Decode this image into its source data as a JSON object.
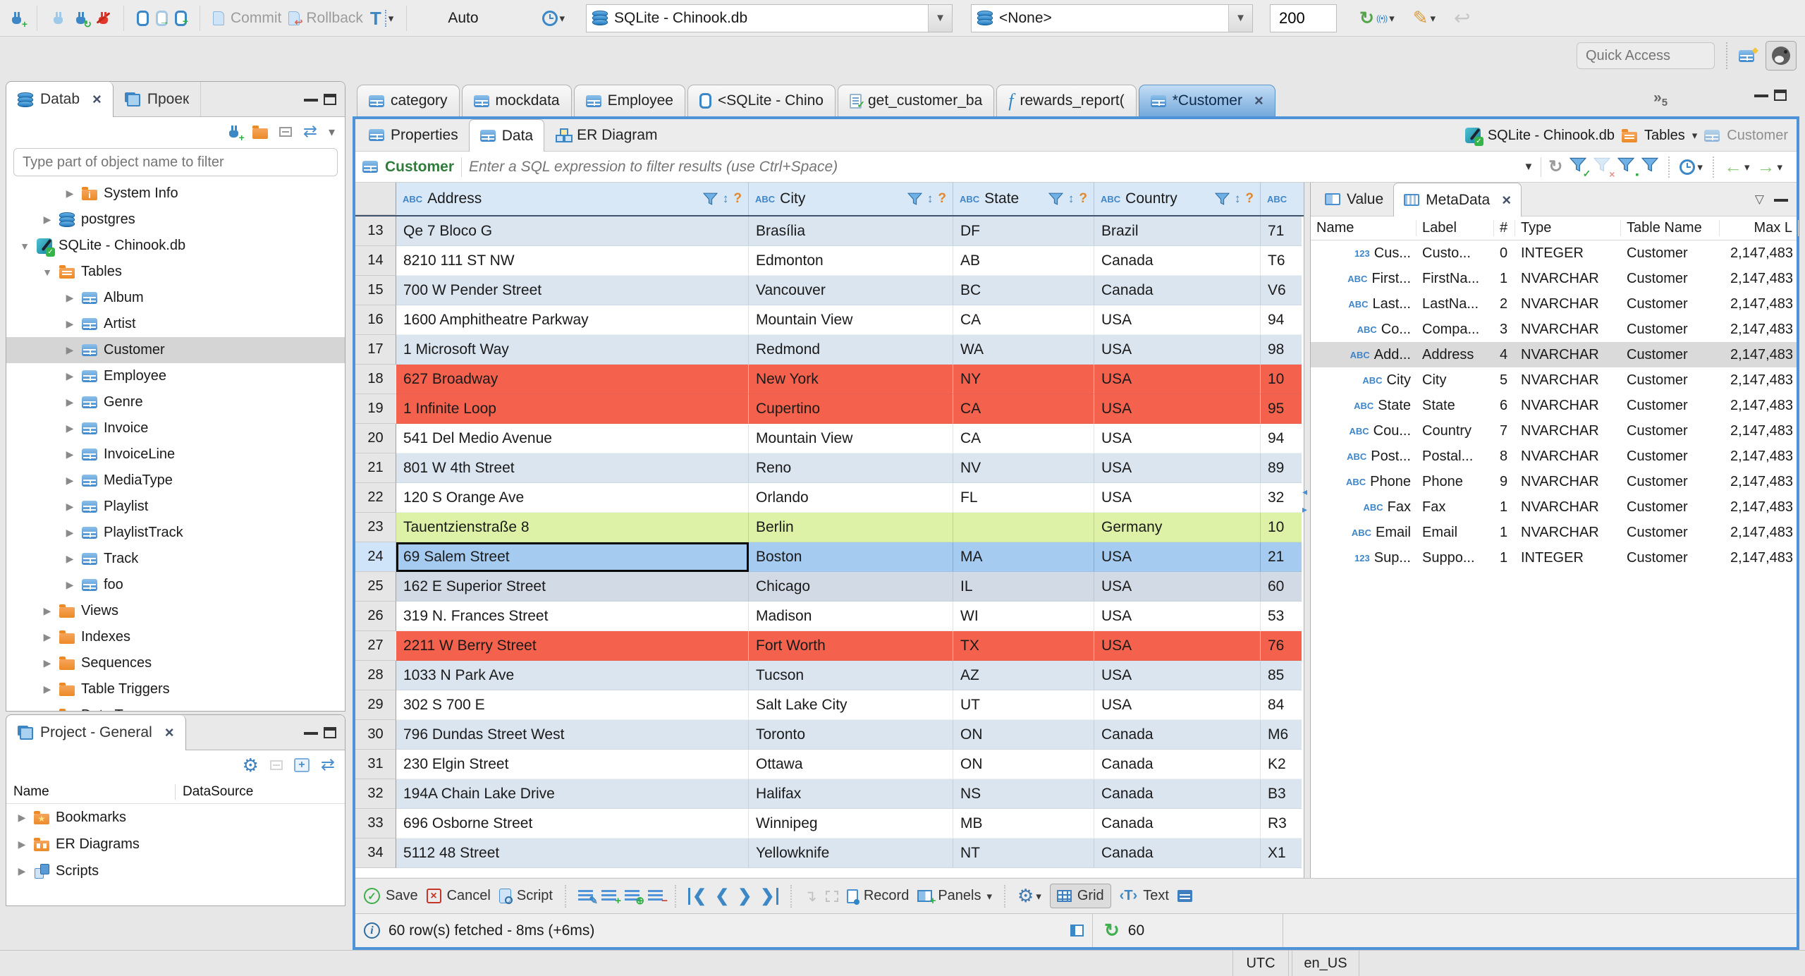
{
  "colors": {
    "accent": "#4e93d8",
    "row_red": "#f4614c",
    "row_green": "#ddf2a6",
    "row_alt": "#dbe5f0",
    "row_selected": "#a6cbf0",
    "row_gray": "#d2dbe5",
    "header_blue": "#d9e8f7",
    "filter_table_green": "#2e7d39",
    "tab_active_top": "#c3ddf5",
    "tab_active_bottom": "#74a9dc"
  },
  "icons": {
    "tree_collapsed": "▶",
    "tree_expanded": "▼",
    "dropdown_caret": "▾",
    "combo_arrow": "▼",
    "refresh": "↻",
    "sort": "↕",
    "unknown_sort": "?",
    "link_editor": "⇄",
    "close": "×",
    "overflow_chevrons": "»",
    "left_arrow": "←",
    "right_arrow": "→",
    "text_type_badge": "ABC",
    "numeric_type_badge": "123",
    "panel_chevron": "▽"
  },
  "topbar": {
    "commit_label": "Commit",
    "rollback_label": "Rollback",
    "auto_label": "Auto",
    "database_combo": "SQLite - Chinook.db",
    "schema_combo": "<None>",
    "fetch_size": "200",
    "quick_access_placeholder": "Quick Access"
  },
  "navigator": {
    "tab_database_label": "Datab",
    "tab_projects_label": "Проек",
    "filter_placeholder": "Type part of object name to filter",
    "tree": [
      {
        "label": "System Info",
        "level": 2,
        "state": "collapsed",
        "icon": "folder-info"
      },
      {
        "label": "postgres",
        "level": 1,
        "state": "collapsed",
        "icon": "db"
      },
      {
        "label": "SQLite - Chinook.db",
        "level": 0,
        "state": "expanded",
        "icon": "sqlite"
      },
      {
        "label": "Tables",
        "level": 1,
        "state": "expanded",
        "icon": "folder-table"
      },
      {
        "label": "Album",
        "level": 2,
        "state": "collapsed",
        "icon": "table"
      },
      {
        "label": "Artist",
        "level": 2,
        "state": "collapsed",
        "icon": "table"
      },
      {
        "label": "Customer",
        "level": 2,
        "state": "collapsed",
        "icon": "table",
        "selected": true
      },
      {
        "label": "Employee",
        "level": 2,
        "state": "collapsed",
        "icon": "table"
      },
      {
        "label": "Genre",
        "level": 2,
        "state": "collapsed",
        "icon": "table"
      },
      {
        "label": "Invoice",
        "level": 2,
        "state": "collapsed",
        "icon": "table"
      },
      {
        "label": "InvoiceLine",
        "level": 2,
        "state": "collapsed",
        "icon": "table"
      },
      {
        "label": "MediaType",
        "level": 2,
        "state": "collapsed",
        "icon": "table"
      },
      {
        "label": "Playlist",
        "level": 2,
        "state": "collapsed",
        "icon": "table"
      },
      {
        "label": "PlaylistTrack",
        "level": 2,
        "state": "collapsed",
        "icon": "table"
      },
      {
        "label": "Track",
        "level": 2,
        "state": "collapsed",
        "icon": "table"
      },
      {
        "label": "foo",
        "level": 2,
        "state": "collapsed",
        "icon": "table"
      },
      {
        "label": "Views",
        "level": 1,
        "state": "collapsed",
        "icon": "folder"
      },
      {
        "label": "Indexes",
        "level": 1,
        "state": "collapsed",
        "icon": "folder"
      },
      {
        "label": "Sequences",
        "level": 1,
        "state": "collapsed",
        "icon": "folder"
      },
      {
        "label": "Table Triggers",
        "level": 1,
        "state": "collapsed",
        "icon": "folder"
      },
      {
        "label": "Data Types",
        "level": 1,
        "state": "collapsed",
        "icon": "folder"
      }
    ]
  },
  "project_panel": {
    "title": "Project - General",
    "columns": [
      "Name",
      "DataSource"
    ],
    "items": [
      {
        "label": "Bookmarks",
        "icon": "folder-star"
      },
      {
        "label": "ER Diagrams",
        "icon": "folder-er"
      },
      {
        "label": "Scripts",
        "icon": "scripts"
      }
    ]
  },
  "editor": {
    "tabs": [
      {
        "label": "category",
        "icon": "table"
      },
      {
        "label": "mockdata",
        "icon": "table"
      },
      {
        "label": "Employee",
        "icon": "table"
      },
      {
        "label": "<SQLite - Chino",
        "icon": "sqlscript"
      },
      {
        "label": "get_customer_ba",
        "icon": "script-check"
      },
      {
        "label": "rewards_report(",
        "icon": "func"
      },
      {
        "label": "*Customer",
        "icon": "table",
        "active": true
      }
    ],
    "overflow_count": "5",
    "result_tabs": [
      {
        "label": "Properties"
      },
      {
        "label": "Data",
        "active": true
      },
      {
        "label": "ER Diagram"
      }
    ],
    "breadcrumb": {
      "database": "SQLite - Chinook.db",
      "container": "Tables",
      "table": "Customer"
    }
  },
  "filter_bar": {
    "table_label": "Customer",
    "placeholder": "Enter a SQL expression to filter results (use Ctrl+Space)"
  },
  "grid": {
    "columns": [
      "Address",
      "City",
      "State",
      "Country"
    ],
    "rows": [
      {
        "num": "13",
        "bg": "alt",
        "cells": [
          "Qe 7 Bloco G",
          "Brasília",
          "DF",
          "Brazil",
          "71"
        ]
      },
      {
        "num": "14",
        "bg": "white",
        "cells": [
          "8210 111 ST NW",
          "Edmonton",
          "AB",
          "Canada",
          "T6"
        ]
      },
      {
        "num": "15",
        "bg": "alt",
        "cells": [
          "700 W Pender Street",
          "Vancouver",
          "BC",
          "Canada",
          "V6"
        ]
      },
      {
        "num": "16",
        "bg": "white",
        "cells": [
          "1600 Amphitheatre Parkway",
          "Mountain View",
          "CA",
          "USA",
          "94"
        ]
      },
      {
        "num": "17",
        "bg": "alt",
        "cells": [
          "1 Microsoft Way",
          "Redmond",
          "WA",
          "USA",
          "98"
        ]
      },
      {
        "num": "18",
        "bg": "red",
        "cells": [
          "627 Broadway",
          "New York",
          "NY",
          "USA",
          "10"
        ]
      },
      {
        "num": "19",
        "bg": "red",
        "cells": [
          "1 Infinite Loop",
          "Cupertino",
          "CA",
          "USA",
          "95"
        ]
      },
      {
        "num": "20",
        "bg": "white",
        "cells": [
          "541 Del Medio Avenue",
          "Mountain View",
          "CA",
          "USA",
          "94"
        ]
      },
      {
        "num": "21",
        "bg": "alt",
        "cells": [
          "801 W 4th Street",
          "Reno",
          "NV",
          "USA",
          "89"
        ]
      },
      {
        "num": "22",
        "bg": "white",
        "cells": [
          "120 S Orange Ave",
          "Orlando",
          "FL",
          "USA",
          "32"
        ]
      },
      {
        "num": "23",
        "bg": "green",
        "cells": [
          "Tauentzienstraße 8",
          "Berlin",
          "",
          "Germany",
          "10"
        ]
      },
      {
        "num": "24",
        "bg": "sel",
        "cells": [
          "69 Salem Street",
          "Boston",
          "MA",
          "USA",
          "21"
        ],
        "focus_cell": 0
      },
      {
        "num": "25",
        "bg": "gray",
        "cells": [
          "162 E Superior Street",
          "Chicago",
          "IL",
          "USA",
          "60"
        ]
      },
      {
        "num": "26",
        "bg": "white",
        "cells": [
          "319 N. Frances Street",
          "Madison",
          "WI",
          "USA",
          "53"
        ]
      },
      {
        "num": "27",
        "bg": "red",
        "cells": [
          "2211 W Berry Street",
          "Fort Worth",
          "TX",
          "USA",
          "76"
        ]
      },
      {
        "num": "28",
        "bg": "alt",
        "cells": [
          "1033 N Park Ave",
          "Tucson",
          "AZ",
          "USA",
          "85"
        ]
      },
      {
        "num": "29",
        "bg": "white",
        "cells": [
          "302 S 700 E",
          "Salt Lake City",
          "UT",
          "USA",
          "84"
        ]
      },
      {
        "num": "30",
        "bg": "alt",
        "cells": [
          "796 Dundas Street West",
          "Toronto",
          "ON",
          "Canada",
          "M6"
        ]
      },
      {
        "num": "31",
        "bg": "white",
        "cells": [
          "230 Elgin Street",
          "Ottawa",
          "ON",
          "Canada",
          "K2"
        ]
      },
      {
        "num": "32",
        "bg": "alt",
        "cells": [
          "194A Chain Lake Drive",
          "Halifax",
          "NS",
          "Canada",
          "B3"
        ]
      },
      {
        "num": "33",
        "bg": "white",
        "cells": [
          "696 Osborne Street",
          "Winnipeg",
          "MB",
          "Canada",
          "R3"
        ]
      },
      {
        "num": "34",
        "bg": "alt",
        "cells": [
          "5112 48 Street",
          "Yellowknife",
          "NT",
          "Canada",
          "X1"
        ]
      }
    ]
  },
  "metadata_panel": {
    "tab_value": "Value",
    "tab_metadata": "MetaData",
    "columns": [
      "Name",
      "Label",
      "#",
      "Type",
      "Table Name",
      "Max L"
    ],
    "rows": [
      {
        "icon": "123",
        "name": "Cus...",
        "label": "Custo...",
        "num": "0",
        "type": "INTEGER",
        "table": "Customer",
        "max": "2,147,483"
      },
      {
        "icon": "abc",
        "name": "First...",
        "label": "FirstNa...",
        "num": "1",
        "type": "NVARCHAR",
        "table": "Customer",
        "max": "2,147,483"
      },
      {
        "icon": "abc",
        "name": "Last...",
        "label": "LastNa...",
        "num": "2",
        "type": "NVARCHAR",
        "table": "Customer",
        "max": "2,147,483"
      },
      {
        "icon": "abc",
        "name": "Co...",
        "label": "Compa...",
        "num": "3",
        "type": "NVARCHAR",
        "table": "Customer",
        "max": "2,147,483"
      },
      {
        "icon": "abc",
        "name": "Add...",
        "label": "Address",
        "num": "4",
        "type": "NVARCHAR",
        "table": "Customer",
        "max": "2,147,483",
        "selected": true
      },
      {
        "icon": "abc",
        "name": "City",
        "label": "City",
        "num": "5",
        "type": "NVARCHAR",
        "table": "Customer",
        "max": "2,147,483"
      },
      {
        "icon": "abc",
        "name": "State",
        "label": "State",
        "num": "6",
        "type": "NVARCHAR",
        "table": "Customer",
        "max": "2,147,483"
      },
      {
        "icon": "abc",
        "name": "Cou...",
        "label": "Country",
        "num": "7",
        "type": "NVARCHAR",
        "table": "Customer",
        "max": "2,147,483"
      },
      {
        "icon": "abc",
        "name": "Post...",
        "label": "Postal...",
        "num": "8",
        "type": "NVARCHAR",
        "table": "Customer",
        "max": "2,147,483"
      },
      {
        "icon": "abc",
        "name": "Phone",
        "label": "Phone",
        "num": "9",
        "type": "NVARCHAR",
        "table": "Customer",
        "max": "2,147,483"
      },
      {
        "icon": "abc",
        "name": "Fax",
        "label": "Fax",
        "num": "1",
        "type": "NVARCHAR",
        "table": "Customer",
        "max": "2,147,483"
      },
      {
        "icon": "abc",
        "name": "Email",
        "label": "Email",
        "num": "1",
        "type": "NVARCHAR",
        "table": "Customer",
        "max": "2,147,483"
      },
      {
        "icon": "123",
        "name": "Sup...",
        "label": "Suppo...",
        "num": "1",
        "type": "INTEGER",
        "table": "Customer",
        "max": "2,147,483"
      }
    ]
  },
  "bottom_toolbar": {
    "save": "Save",
    "cancel": "Cancel",
    "script": "Script",
    "record": "Record",
    "panels": "Panels",
    "grid": "Grid",
    "text": "Text"
  },
  "status_row": {
    "message": "60 row(s) fetched - 8ms (+6ms)",
    "refresh_count": "60"
  },
  "os_statusbar": {
    "timezone": "UTC",
    "locale": "en_US"
  }
}
